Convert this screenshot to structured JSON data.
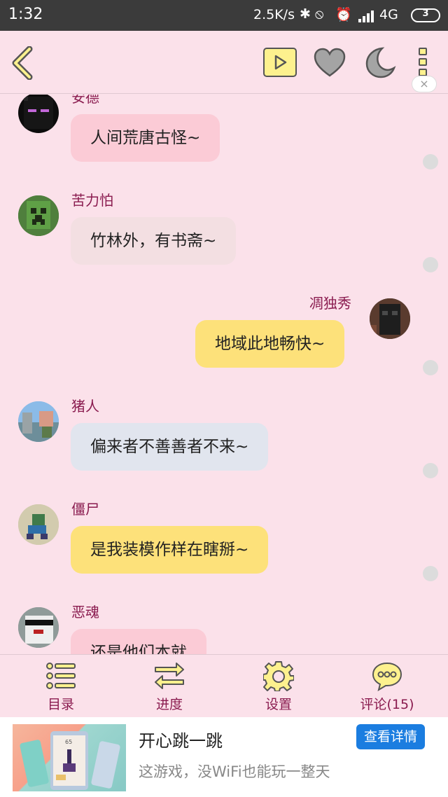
{
  "status_bar": {
    "time": "1:32",
    "net_speed": "2.5K/s",
    "bluetooth_icon": "✱",
    "mute_icon": "⦸",
    "alarm_icon": "⏰",
    "network_type": "4G",
    "battery_level": "3"
  },
  "top_bar": {
    "icons": [
      "back-arrow-icon",
      "play-icon",
      "heart-icon",
      "moon-icon",
      "more-icon"
    ]
  },
  "messages": [
    {
      "side": "left",
      "name": "安德",
      "text": "人间荒唐古怪~",
      "bubble_color": "#fbcbd6",
      "avatar": "enderman"
    },
    {
      "side": "left",
      "name": "苦力怕",
      "text": "竹林外，有书斋~",
      "bubble_color": "#f3dfe2",
      "avatar": "creeper"
    },
    {
      "side": "right",
      "name": "凋独秀",
      "text": "地域此地畅快~",
      "bubble_color": "#fde17a",
      "avatar": "wither-skeleton"
    },
    {
      "side": "left",
      "name": "猪人",
      "text": "偏来者不善善者不来~",
      "bubble_color": "#e1e5ee",
      "avatar": "pigman"
    },
    {
      "side": "left",
      "name": "僵尸",
      "text": "是我装模作样在瞎掰~",
      "bubble_color": "#fde17a",
      "avatar": "zombie"
    },
    {
      "side": "left",
      "name": "恶魂",
      "text": "还是他们本就",
      "bubble_color": "#fbcbd6",
      "avatar": "ghast"
    }
  ],
  "tabs": [
    {
      "label": "目录",
      "icon": "list-icon"
    },
    {
      "label": "进度",
      "icon": "swap-arrows-icon"
    },
    {
      "label": "设置",
      "icon": "gear-icon"
    },
    {
      "label": "评论(15)",
      "icon": "comment-bubble-icon"
    }
  ],
  "ad": {
    "title": "开心跳一跳",
    "description": "这游戏，没WiFi也能玩一整天",
    "button_label": "查看详情",
    "close_label": "×",
    "image_score": "65"
  }
}
